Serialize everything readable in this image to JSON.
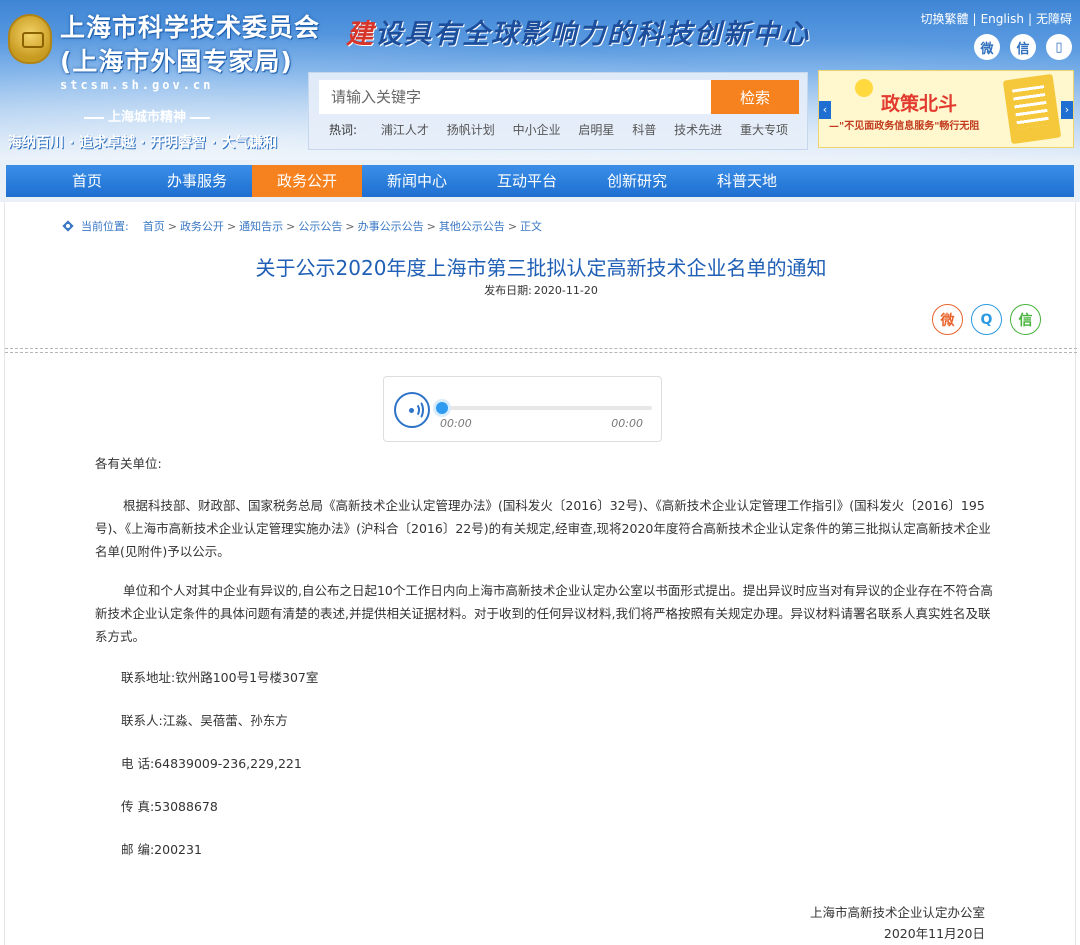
{
  "header": {
    "org_name_line1": "上海市科学技术委员会",
    "org_name_line2": "(上海市外国专家局)",
    "domain": "stcsm.sh.gov.cn",
    "spirit_title": "上海城市精神",
    "spirit_text": "海纳百川 · 追求卓越 · 开明睿智 · 大气谦和",
    "slogan_a": "建",
    "slogan_b": "设具有全球影响力的科技创新中心",
    "links": [
      "切换繁體",
      "English",
      "无障碍"
    ],
    "social": [
      {
        "icon": "weibo-icon",
        "glyph": "微"
      },
      {
        "icon": "wechat-icon",
        "glyph": "信"
      },
      {
        "icon": "mobile-icon",
        "glyph": "▯"
      }
    ]
  },
  "search": {
    "placeholder": "请输入关键字",
    "button": "检索",
    "hot_label": "热词:",
    "hot_words": [
      "浦江人才",
      "扬帆计划",
      "中小企业",
      "启明星",
      "科普",
      "技术先进",
      "重大专项"
    ]
  },
  "banner": {
    "title": "政策北斗",
    "subtitle": "—\"不见面政务信息服务\"畅行无阻",
    "prev": "‹",
    "next": "›"
  },
  "nav": {
    "items": [
      "首页",
      "办事服务",
      "政务公开",
      "新闻中心",
      "互动平台",
      "创新研究",
      "科普天地"
    ],
    "active_index": 2
  },
  "breadcrumb": {
    "label": "当前位置:",
    "items": [
      "首页",
      "政务公开",
      "通知告示",
      "公示公告",
      "办事公示公告",
      "其他公示公告",
      "正文"
    ]
  },
  "article": {
    "title": "关于公示2020年度上海市第三批拟认定高新技术企业名单的通知",
    "date_label": "发布日期:",
    "date": "2020-11-20",
    "share": [
      {
        "icon": "weibo-share-icon",
        "glyph": "微"
      },
      {
        "icon": "qq-share-icon",
        "glyph": "Q"
      },
      {
        "icon": "wechat-share-icon",
        "glyph": "信"
      }
    ],
    "audio": {
      "current": "00:00",
      "total": "00:00",
      "progress": 0
    },
    "greeting": "各有关单位:",
    "para1": "根据科技部、财政部、国家税务总局《高新技术企业认定管理办法》(国科发火〔2016〕32号)、《高新技术企业认定管理工作指引》(国科发火〔2016〕195号)、《上海市高新技术企业认定管理实施办法》(沪科合〔2016〕22号)的有关规定,经审查,现将2020年度符合高新技术企业认定条件的第三批拟认定高新技术企业名单(见附件)予以公示。",
    "para2": "单位和个人对其中企业有异议的,自公布之日起10个工作日内向上海市高新技术企业认定办公室以书面形式提出。提出异议时应当对有异议的企业存在不符合高新技术企业认定条件的具体问题有清楚的表述,并提供相关证据材料。对于收到的任何异议材料,我们将严格按照有关规定办理。异议材料请署名联系人真实姓名及联系方式。",
    "address": "联系地址:钦州路100号1号楼307室",
    "contacts": "联系人:江淼、吴蓓蕾、孙东方",
    "phone": "电 话:64839009-236,229,221",
    "fax": "传 真:53088678",
    "zip": "邮 编:200231",
    "sign_org": "上海市高新技术企业认定办公室",
    "sign_date": "2020年11月20日"
  }
}
